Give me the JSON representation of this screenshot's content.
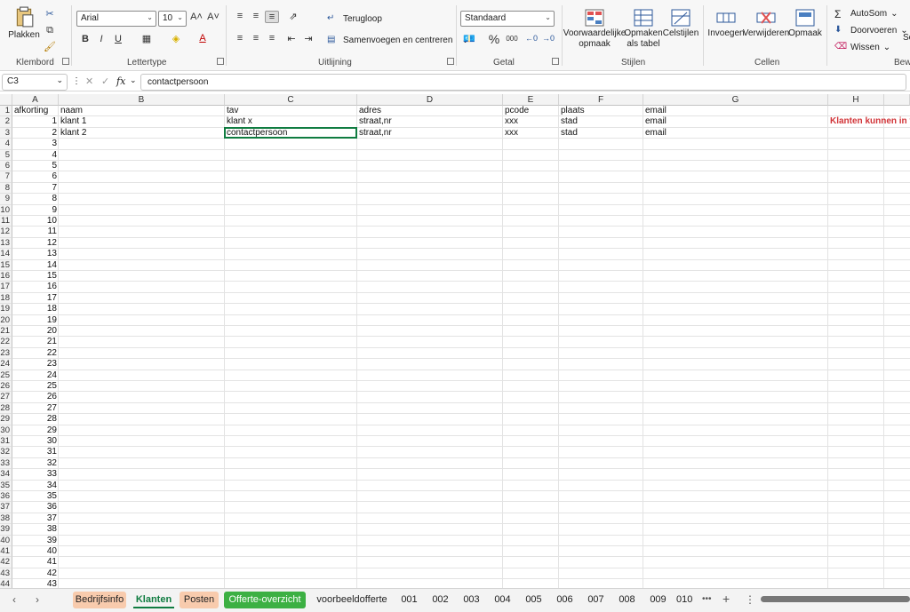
{
  "ribbon": {
    "clipboard": {
      "paste_label": "Plakken",
      "group_label": "Klembord"
    },
    "font": {
      "font_name": "Arial",
      "font_size": "10",
      "group_label": "Lettertype",
      "bold": "B",
      "italic": "I",
      "underline": "U",
      "grow": "A˄",
      "shrink": "A˅"
    },
    "alignment": {
      "wrap_label": "Terugloop",
      "merge_label": "Samenvoegen en centreren",
      "group_label": "Uitlijning"
    },
    "number": {
      "format_value": "Standaard",
      "percent": "%",
      "thousands": "000",
      "group_label": "Getal"
    },
    "styles": {
      "conditional_label": "Voorwaardelijke opmaak",
      "table_label": "Opmaken als tabel",
      "cell_styles_label": "Celstijlen",
      "group_label": "Stijlen"
    },
    "cells": {
      "insert_label": "Invoegen",
      "delete_label": "Verwijderen",
      "format_label": "Opmaak",
      "group_label": "Cellen"
    },
    "editing": {
      "autosum_label": "AutoSom",
      "fill_label": "Doorvoeren",
      "clear_label": "Wissen",
      "group_label_partial": "Bewe",
      "sort_partial": "So"
    }
  },
  "formula_bar": {
    "name_box": "C3",
    "fx": "fx",
    "formula": "contactpersoon"
  },
  "columns": [
    "A",
    "B",
    "C",
    "D",
    "E",
    "F",
    "G",
    "H"
  ],
  "headers_row": {
    "A": "afkorting",
    "B": "naam",
    "C": "tav",
    "D": "adres",
    "E": "pcode",
    "F": "plaats",
    "G": "email"
  },
  "data_rows": [
    {
      "A": "1",
      "B": "klant 1",
      "C": "klant x",
      "D": "straat,nr",
      "E": "xxx",
      "F": "stad",
      "G": "email",
      "H": "Klanten kunnen in v"
    },
    {
      "A": "2",
      "B": "klant 2",
      "C": "contactpersoon",
      "D": "straat,nr",
      "E": "xxx",
      "F": "stad",
      "G": "email"
    }
  ],
  "row_numbers": [
    "1",
    "2",
    "3",
    "4",
    "5",
    "6",
    "7",
    "8",
    "9",
    "10",
    "11",
    "12",
    "13",
    "14",
    "15",
    "16",
    "17",
    "18",
    "19",
    "20",
    "21",
    "22",
    "23",
    "24",
    "25",
    "26",
    "27",
    "28",
    "29",
    "30",
    "31",
    "32",
    "33",
    "34",
    "35",
    "36",
    "37",
    "38",
    "39",
    "40",
    "41",
    "42",
    "43",
    "44"
  ],
  "col_a_values": [
    "3",
    "4",
    "5",
    "6",
    "7",
    "8",
    "9",
    "10",
    "11",
    "12",
    "13",
    "14",
    "15",
    "16",
    "17",
    "18",
    "19",
    "20",
    "21",
    "22",
    "23",
    "24",
    "25",
    "26",
    "27",
    "28",
    "29",
    "30",
    "31",
    "32",
    "33",
    "34",
    "35",
    "36",
    "37",
    "38",
    "39",
    "40",
    "41",
    "42",
    "43"
  ],
  "sheet_tabs": [
    {
      "label": "Bedrijfsinfo",
      "color": "#f8cbad"
    },
    {
      "label": "Klanten",
      "color": "",
      "active": true
    },
    {
      "label": "Posten",
      "color": "#f8cbad"
    },
    {
      "label": "Offerte-overzicht",
      "color": "#3cb043"
    },
    {
      "label": "voorbeeldofferte",
      "color": ""
    },
    {
      "label": "001",
      "color": ""
    },
    {
      "label": "002",
      "color": ""
    },
    {
      "label": "003",
      "color": ""
    },
    {
      "label": "004",
      "color": ""
    },
    {
      "label": "005",
      "color": ""
    },
    {
      "label": "006",
      "color": ""
    },
    {
      "label": "007",
      "color": ""
    },
    {
      "label": "008",
      "color": ""
    },
    {
      "label": "009",
      "color": ""
    },
    {
      "label": "010",
      "color": ""
    }
  ],
  "tab_more": "•••",
  "tab_add": "+",
  "accent": "#107c41",
  "note_color": "#d13438"
}
